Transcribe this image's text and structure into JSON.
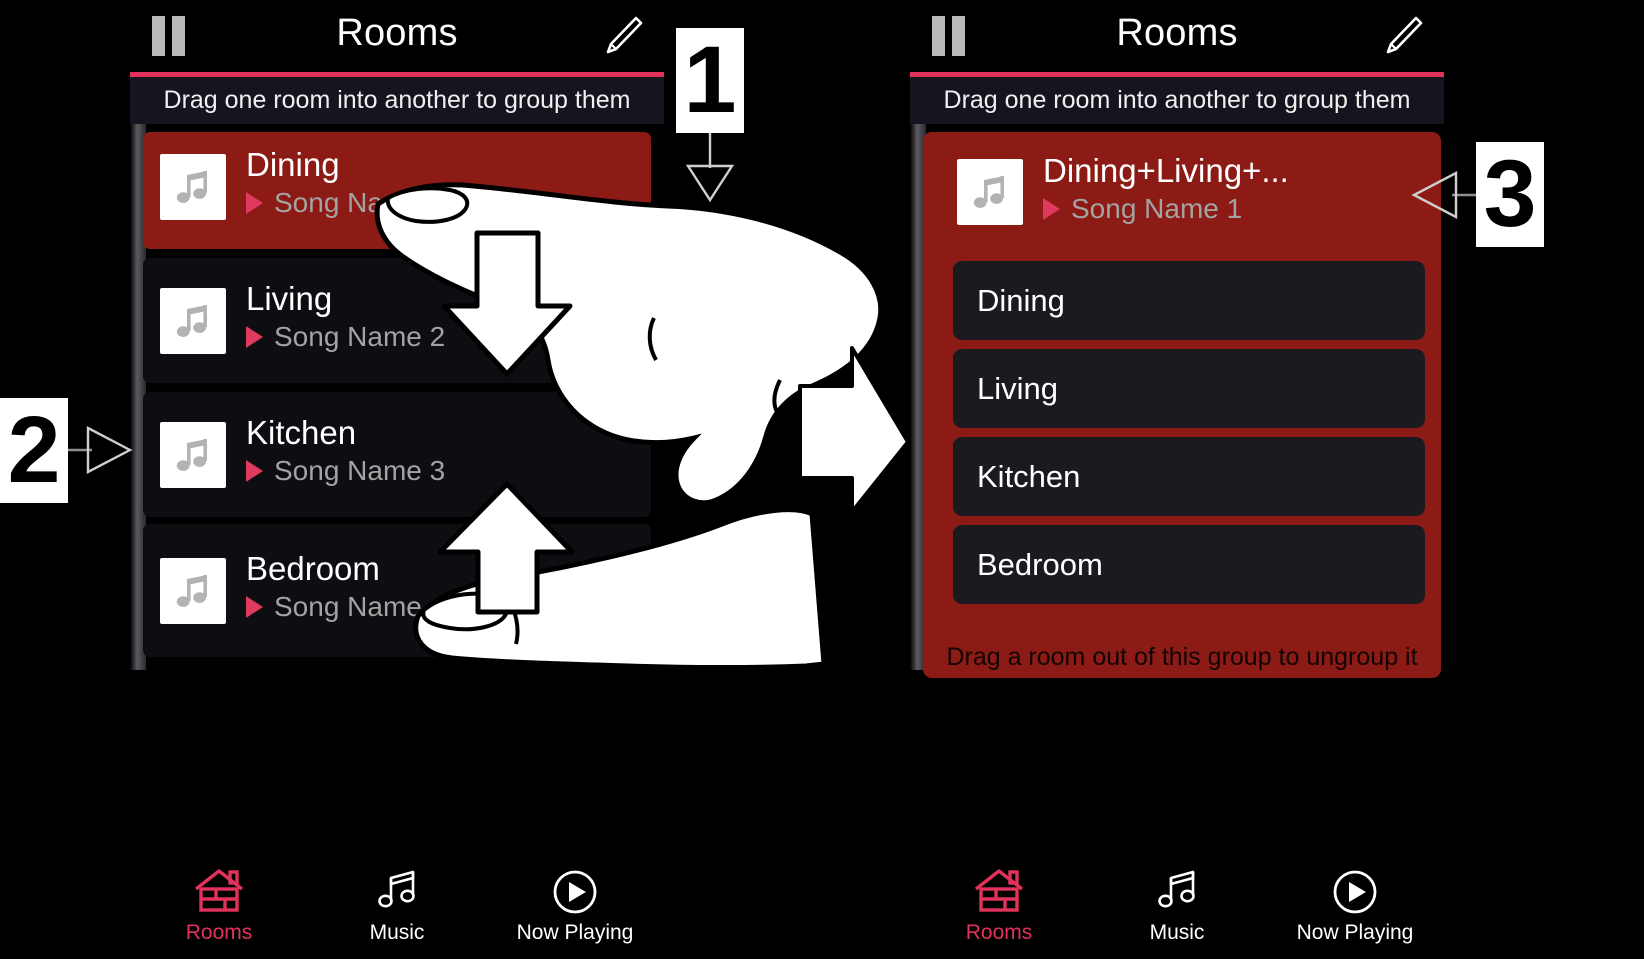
{
  "screens": [
    {
      "id": "before",
      "header": {
        "title": "Rooms",
        "pause_icon": "pause-icon",
        "edit_icon": "pencil-icon"
      },
      "hint": "Drag one room into another to group them",
      "rooms": [
        {
          "name": "Dining",
          "song": "Song Name 1",
          "selected": true,
          "art_icon": "music-note-icon"
        },
        {
          "name": "Living",
          "song": "Song Name 2",
          "selected": false,
          "art_icon": "music-note-icon"
        },
        {
          "name": "Kitchen",
          "song": "Song Name 3",
          "selected": false,
          "art_icon": "music-note-icon"
        },
        {
          "name": "Bedroom",
          "song": "Song Name 4",
          "selected": false,
          "art_icon": "music-note-icon"
        }
      ],
      "tabs": [
        {
          "label": "Rooms",
          "icon": "house-icon",
          "active": true
        },
        {
          "label": "Music",
          "icon": "music-note-icon",
          "active": false
        },
        {
          "label": "Now Playing",
          "icon": "play-circle-icon",
          "active": false
        }
      ]
    },
    {
      "id": "after",
      "header": {
        "title": "Rooms",
        "pause_icon": "pause-icon",
        "edit_icon": "pencil-icon"
      },
      "hint": "Drag one room into another to group them",
      "group": {
        "name": "Dining+Living+...",
        "song": "Song Name 1",
        "art_icon": "music-note-icon",
        "members": [
          "Dining",
          "Living",
          "Kitchen",
          "Bedroom"
        ],
        "footer": "Drag a room out of this group to ungroup it"
      },
      "tabs": [
        {
          "label": "Rooms",
          "icon": "house-icon",
          "active": true
        },
        {
          "label": "Music",
          "icon": "music-note-icon",
          "active": false
        },
        {
          "label": "Now Playing",
          "icon": "play-circle-icon",
          "active": false
        }
      ]
    }
  ],
  "callouts": [
    {
      "number": "1",
      "arrow": "down-arrow-icon"
    },
    {
      "number": "2",
      "arrow": "right-arrow-icon"
    },
    {
      "number": "3",
      "arrow": "left-arrow-icon"
    }
  ],
  "illustration": {
    "hand_top": "pointing-hand-icon",
    "hand_bottom": "pointing-hand-icon",
    "drag_down_arrow": "down-arrow-icon",
    "drag_up_arrow": "up-arrow-icon",
    "transition_arrow": "right-arrow-icon"
  },
  "colors": {
    "accent": "#e2325c",
    "selected_row": "#8d1b15",
    "row": "#0e0d12",
    "sub_room": "#1a1a20",
    "hint_bar": "#15151f",
    "background": "#000000"
  }
}
